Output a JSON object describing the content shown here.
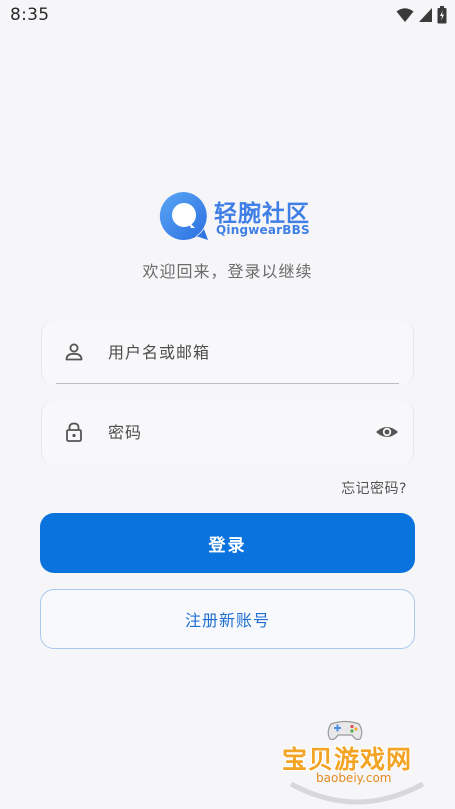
{
  "status_bar": {
    "time": "8:35",
    "icons": [
      "wifi-icon",
      "signal-icon",
      "battery-icon"
    ]
  },
  "logo": {
    "name_cn": "轻腕社区",
    "name_en": "QingwearBBS",
    "brand_color": "#3f7fe6"
  },
  "subtitle": "欢迎回来，登录以继续",
  "form": {
    "username": {
      "value": "",
      "placeholder": "用户名或邮箱",
      "icon": "person-icon"
    },
    "password": {
      "value": "",
      "placeholder": "密码",
      "icon": "lock-icon",
      "toggle_icon": "eye-icon"
    },
    "forgot_label": "忘记密码?",
    "login_label": "登录",
    "register_label": "注册新账号"
  },
  "colors": {
    "primary": "#0b73dd",
    "background": "#f6f6f9",
    "register_border": "#a9c8ee",
    "register_text": "#1f6fd0"
  },
  "watermark": {
    "text_cn": "宝贝游戏网",
    "url": "baobeiy.com"
  }
}
